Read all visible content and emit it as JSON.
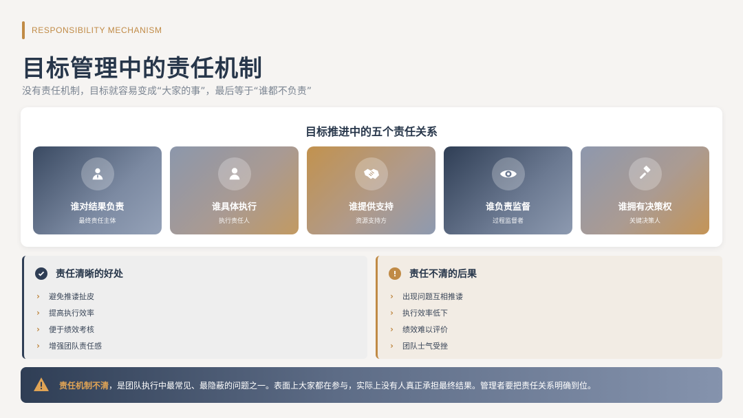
{
  "header": {
    "tag": "RESPONSIBILITY MECHANISM",
    "title": "目标管理中的责任机制",
    "subtitle": "没有责任机制，目标就容易变成“大家的事”，最后等于“谁都不负责”"
  },
  "panel": {
    "title": "目标推进中的五个责任关系",
    "cards": [
      {
        "title": "谁对结果负责",
        "sub": "最终责任主体",
        "icon": "person-tie-icon"
      },
      {
        "title": "谁具体执行",
        "sub": "执行责任人",
        "icon": "person-icon"
      },
      {
        "title": "谁提供支持",
        "sub": "资源支持方",
        "icon": "handshake-icon"
      },
      {
        "title": "谁负责监督",
        "sub": "过程监督者",
        "icon": "eye-icon"
      },
      {
        "title": "谁拥有决策权",
        "sub": "关键决策人",
        "icon": "gavel-icon"
      }
    ]
  },
  "benefits": {
    "title": "责任清晰的好处",
    "icon": "check-circle-icon",
    "items": [
      "避免推诿扯皮",
      "提高执行效率",
      "便于绩效考核",
      "增强团队责任感"
    ]
  },
  "consequences": {
    "title": "责任不清的后果",
    "icon": "exclamation-circle-icon",
    "items": [
      "出现问题互相推诿",
      "执行效率低下",
      "绩效难以评价",
      "团队士气受挫"
    ]
  },
  "banner": {
    "icon": "warning-icon",
    "strong": "责任机制不清",
    "text": "，是团队执行中最常见、最隐蔽的问题之一。表面上大家都在参与，实际上没有人真正承担最终结果。管理者要把责任关系明确到位。"
  },
  "colors": {
    "accent": "#c08a45",
    "navy": "#2f3e55",
    "background": "#f6f4f2"
  }
}
